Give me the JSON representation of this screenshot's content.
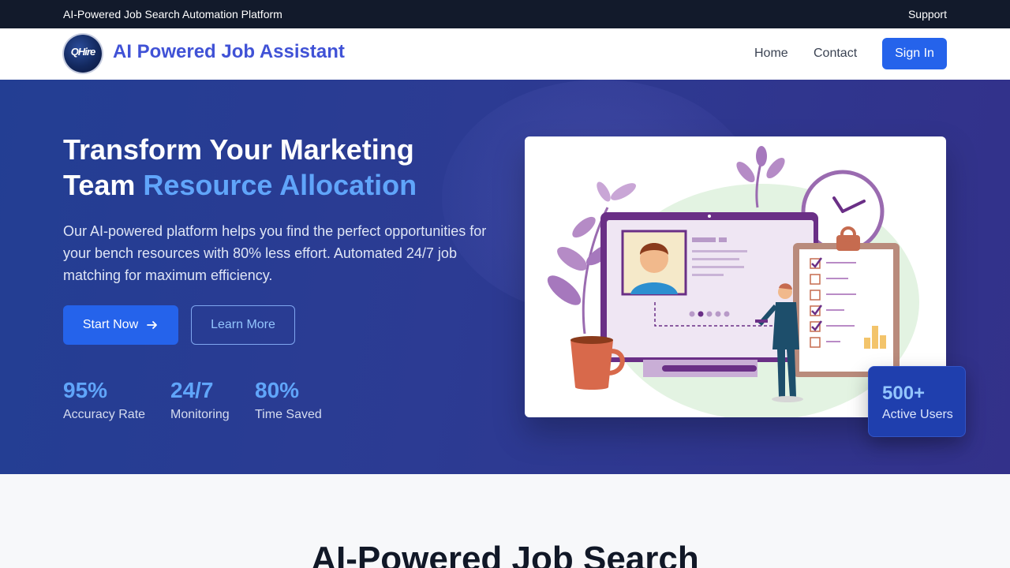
{
  "topbar": {
    "tagline": "AI-Powered Job Search Automation Platform",
    "support": "Support"
  },
  "navbar": {
    "logo_text": "QHire",
    "brand": "AI Powered Job Assistant",
    "links": [
      "Home",
      "Contact"
    ],
    "signin": "Sign In"
  },
  "hero": {
    "headline_line1": "Transform Your Marketing",
    "headline_line2_plain": "Team ",
    "headline_line2_accent": "Resource Allocation",
    "description": "Our AI-powered platform helps you find the perfect opportunities for your bench resources with 80% less effort. Automated 24/7 job matching for maximum efficiency.",
    "start_button": "Start Now",
    "learn_button": "Learn More",
    "stats": [
      {
        "value": "95%",
        "label": "Accuracy Rate"
      },
      {
        "value": "24/7",
        "label": "Monitoring"
      },
      {
        "value": "80%",
        "label": "Time Saved"
      }
    ],
    "users_card": {
      "value": "500+",
      "label": "Active Users"
    }
  },
  "next_section": {
    "title": "AI-Powered Job Search"
  },
  "colors": {
    "primary": "#2563eb",
    "accent": "#60a5fa",
    "topbar": "#121a2b",
    "hero_start": "#233e93",
    "hero_end": "#33318a",
    "brand": "#4052d6"
  },
  "icons": {
    "start_button_icon": "arrow-right-icon",
    "logo": "qhire-logo-icon"
  }
}
